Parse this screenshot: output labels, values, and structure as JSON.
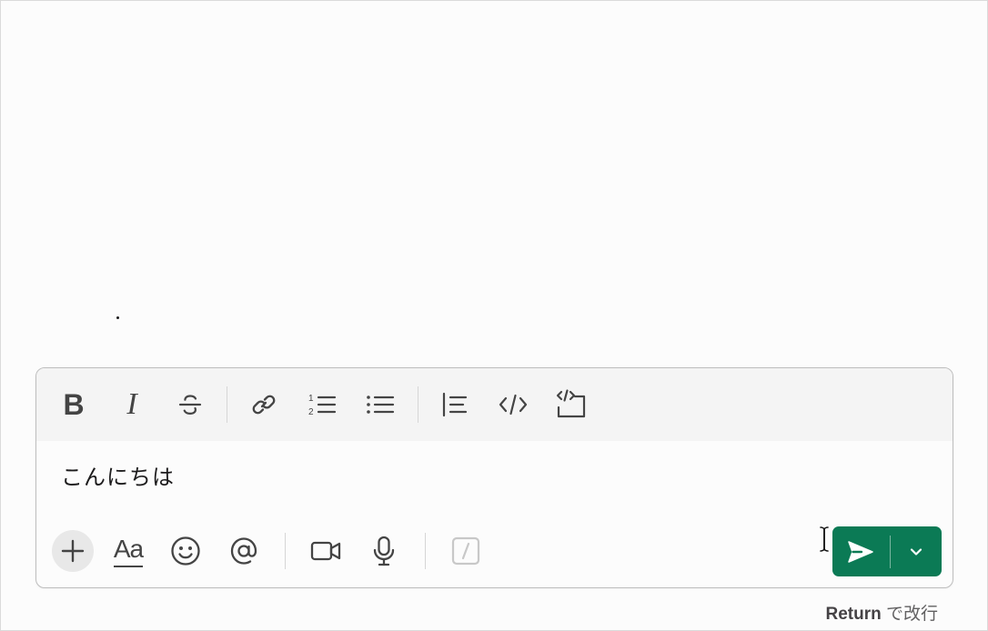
{
  "composer": {
    "message_text": "こんにちは",
    "toolbar": {
      "bold_label": "B",
      "italic_label": "I",
      "numbered_list_digits": [
        "1",
        "2"
      ]
    },
    "bottom": {
      "format_label": "Aa"
    },
    "send": {
      "accent_color": "#0b7a55"
    },
    "hint": {
      "key": "Return",
      "text": "で改行"
    }
  },
  "icons": [
    "bold-icon",
    "italic-icon",
    "strikethrough-icon",
    "link-icon",
    "numbered-list-icon",
    "bulleted-list-icon",
    "blockquote-icon",
    "code-icon",
    "code-block-icon",
    "plus-icon",
    "format-icon",
    "emoji-icon",
    "mention-icon",
    "video-icon",
    "microphone-icon",
    "slash-command-icon",
    "send-icon",
    "chevron-down-icon"
  ]
}
